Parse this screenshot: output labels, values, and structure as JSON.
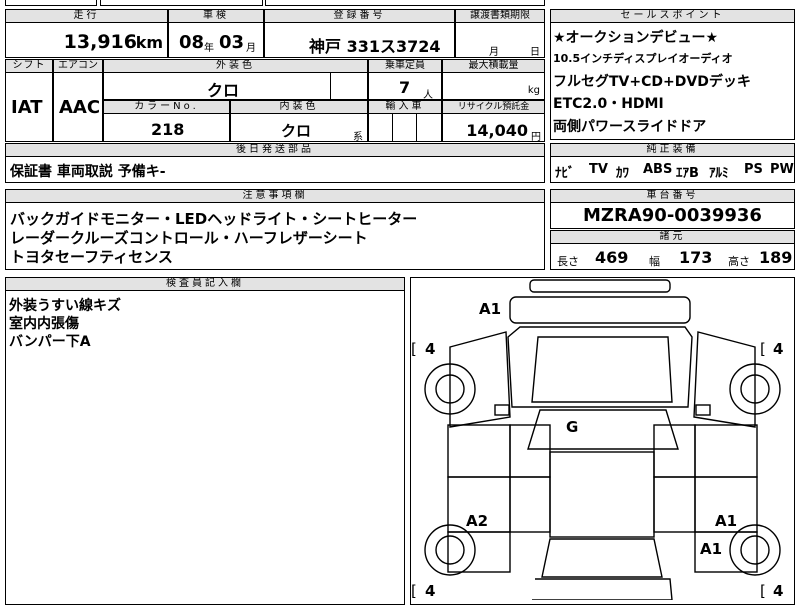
{
  "top": {
    "mileage_label": "走行",
    "mileage_value": "13,916",
    "mileage_unit": "km",
    "inspection_label": "車検",
    "inspection_year": "08",
    "year_unit": "年",
    "inspection_month": "03",
    "month_unit": "月",
    "registration_label": "登録番号",
    "registration_value": "神戸 331ス3724",
    "transfer_label": "譲渡書類期限",
    "transfer_month_unit": "月",
    "transfer_day_unit": "日"
  },
  "middle": {
    "shift_label": "シフト",
    "shift_value": "IAT",
    "aircon_label": "エアコン",
    "aircon_value": "AAC",
    "exterior_label": "外装色",
    "exterior_value": "クロ",
    "capacity_label": "乗車定員",
    "capacity_value": "7",
    "capacity_unit": "人",
    "load_label": "最大積載量",
    "load_unit": "kg",
    "color_no_label": "カラーNo.",
    "color_no_value": "218",
    "interior_label": "内装色",
    "interior_value": "クロ",
    "interior_suffix": "系",
    "import_label": "輸入車",
    "recycle_label": "リサイクル預託金",
    "recycle_value": "14,040",
    "recycle_unit": "円"
  },
  "later_parts": {
    "label": "後日発送部品",
    "value": "保証書 車両取説 予備キ-"
  },
  "notes": {
    "label": "注意事項欄",
    "lines": [
      "バックガイドモニター・LEDヘッドライト・シートヒーター",
      "レーダークルーズコントロール・ハーフレザーシート",
      "トヨタセーフティセンス"
    ]
  },
  "inspector": {
    "label": "検査員記入欄",
    "lines": [
      "外装うすい線キズ",
      "室内内張傷",
      "バンパー下A"
    ]
  },
  "sales": {
    "label": "セールスポイント",
    "lines": [
      "★オークションデビュー★",
      "10.5インチディスプレイオーディオ",
      "フルセグTV+CD+DVDデッキ",
      "ETC2.0・HDMI",
      "両側パワースライドドア"
    ]
  },
  "genuine": {
    "label": "純正装備",
    "items": [
      "ﾅﾋﾞ",
      "TV",
      "ｶﾜ",
      "ABS",
      "ｴｱB",
      "ｱﾙﾐ",
      "PS",
      "PW"
    ]
  },
  "chassis": {
    "label": "車台番号",
    "value": "MZRA90-0039936"
  },
  "specs": {
    "label": "諸元",
    "length_label": "長さ",
    "length_value": "469",
    "width_label": "幅",
    "width_value": "173",
    "height_label": "高さ",
    "height_value": "189"
  },
  "diagram": {
    "tire_front_left": "4",
    "tire_front_right": "4",
    "tire_rear_left": "4",
    "tire_rear_right": "4",
    "bracket_open": "[",
    "marks": [
      "A1",
      "G",
      "A2",
      "A1",
      "A1"
    ]
  }
}
